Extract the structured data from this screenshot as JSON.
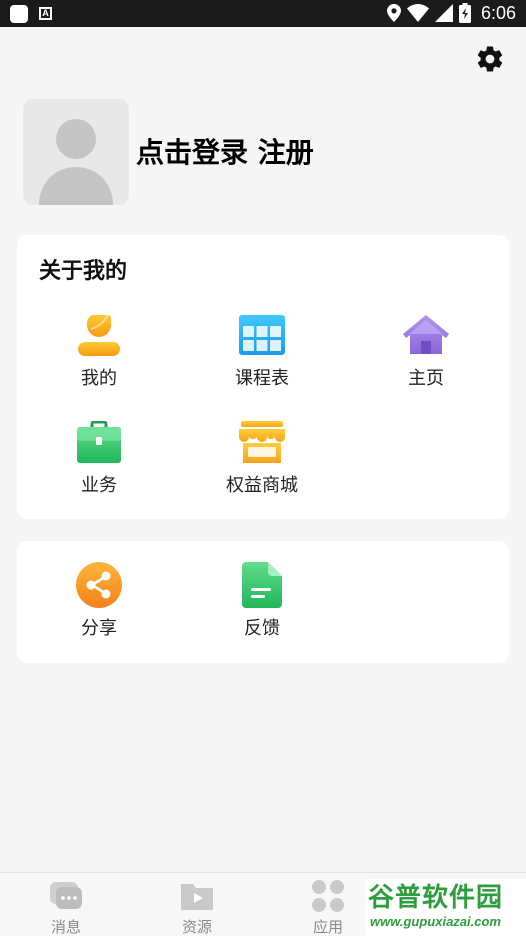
{
  "status_bar": {
    "time": "6:06",
    "a_icon": "A"
  },
  "profile": {
    "login_text": "点击登录 注册"
  },
  "about": {
    "title": "关于我的",
    "items": [
      {
        "label": "我的",
        "icon": "user-icon",
        "color": "#f7a51c"
      },
      {
        "label": "课程表",
        "icon": "timetable-icon",
        "color": "#1ea7f0"
      },
      {
        "label": "主页",
        "icon": "home-icon",
        "color": "#9b7be0"
      },
      {
        "label": "业务",
        "icon": "briefcase-icon",
        "color": "#2fc56b"
      },
      {
        "label": "权益商城",
        "icon": "store-icon",
        "color": "#f7b21c"
      }
    ]
  },
  "more": {
    "items": [
      {
        "label": "分享",
        "icon": "share-icon",
        "color": "#f7931e"
      },
      {
        "label": "反馈",
        "icon": "feedback-document-icon",
        "color": "#2fc56b"
      }
    ]
  },
  "tabbar": {
    "tabs": [
      {
        "label": "消息",
        "icon": "message-icon"
      },
      {
        "label": "资源",
        "icon": "video-folder-icon"
      },
      {
        "label": "应用",
        "icon": "apps-icon"
      }
    ]
  },
  "watermark": {
    "line1": "谷普软件园",
    "line2": "www.gupuxiazai.com"
  }
}
